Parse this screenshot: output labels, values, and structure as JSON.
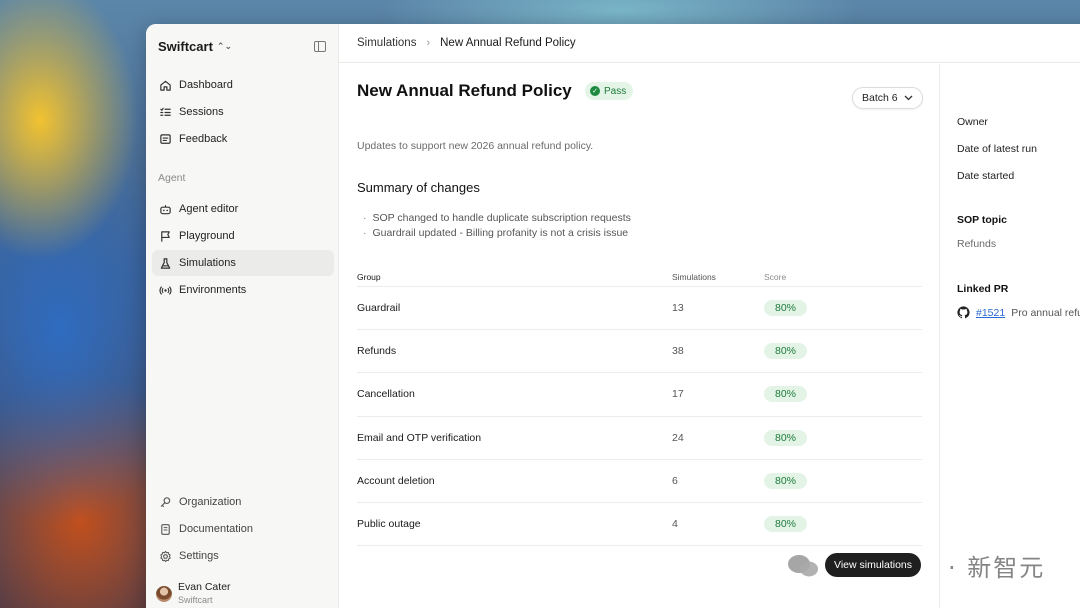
{
  "sidebar": {
    "workspace": "Swiftcart",
    "nav_primary": [
      {
        "label": "Dashboard",
        "icon": "home-icon"
      },
      {
        "label": "Sessions",
        "icon": "list-icon"
      },
      {
        "label": "Feedback",
        "icon": "feedback-icon"
      }
    ],
    "section_agent": "Agent",
    "nav_agent": [
      {
        "label": "Agent editor",
        "icon": "robot-icon"
      },
      {
        "label": "Playground",
        "icon": "flag-icon"
      },
      {
        "label": "Simulations",
        "icon": "flask-icon",
        "active": true
      },
      {
        "label": "Environments",
        "icon": "broadcast-icon"
      }
    ],
    "nav_bottom": [
      {
        "label": "Organization",
        "icon": "key-icon"
      },
      {
        "label": "Documentation",
        "icon": "document-icon"
      },
      {
        "label": "Settings",
        "icon": "gear-icon"
      }
    ],
    "user": {
      "name": "Evan Cater",
      "org": "Swiftcart"
    }
  },
  "breadcrumb": [
    "Simulations",
    "New Annual Refund Policy"
  ],
  "main": {
    "title": "New Annual Refund Policy",
    "status": "Pass",
    "batch_label": "Batch 6",
    "subtitle": "Updates to support new 2026 annual refund policy.",
    "summary_heading": "Summary of changes",
    "summary_items": [
      "SOP changed to handle duplicate subscription requests",
      "Guardrail updated - Billing profanity is not a crisis issue"
    ],
    "table": {
      "headers": [
        "Group",
        "Simulations",
        "Score"
      ],
      "rows": [
        {
          "group": "Guardrail",
          "simulations": "13",
          "score": "80%"
        },
        {
          "group": "Refunds",
          "simulations": "38",
          "score": "80%"
        },
        {
          "group": "Cancellation",
          "simulations": "17",
          "score": "80%"
        },
        {
          "group": "Email and OTP verification",
          "simulations": "24",
          "score": "80%"
        },
        {
          "group": "Account deletion",
          "simulations": "6",
          "score": "80%"
        },
        {
          "group": "Public outage",
          "simulations": "4",
          "score": "80%"
        }
      ]
    }
  },
  "details": {
    "owner_label": "Owner",
    "latest_run_label": "Date of latest run",
    "started_label": "Date started",
    "sop_heading": "SOP topic",
    "sop_value": "Refunds",
    "pr_heading": "Linked PR",
    "pr_number": "#1521",
    "pr_title": "Pro annual refu"
  },
  "toast": "View simulations",
  "watermark": "· 新智元",
  "colors": {
    "accent_green": "#1e7a3a",
    "pill_bg": "#e3f4e7",
    "link_blue": "#2a6bd6"
  }
}
